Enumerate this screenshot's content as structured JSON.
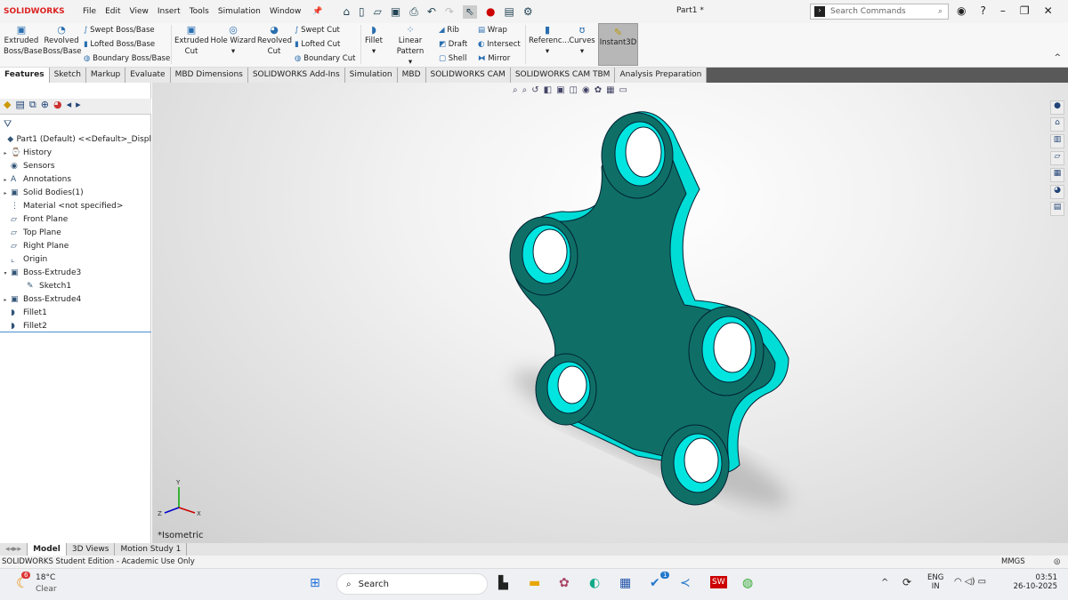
{
  "app": {
    "logo": "SOLIDWORKS",
    "title": "Part1 *",
    "search_placeholder": "Search Commands",
    "menu": [
      "File",
      "Edit",
      "View",
      "Insert",
      "Tools",
      "Simulation",
      "Window"
    ]
  },
  "ribbon": {
    "big": [
      "Extruded Boss/Base",
      "Revolved Boss/Base",
      "Extruded Cut",
      "Hole Wizard",
      "Revolved Cut",
      "Fillet",
      "Linear Pattern",
      "Referenc...",
      "Curves",
      "Instant3D"
    ],
    "small": [
      "Swept Boss/Base",
      "Lofted Boss/Base",
      "Boundary Boss/Base",
      "Swept Cut",
      "Lofted Cut",
      "Boundary Cut",
      "Rib",
      "Draft",
      "Shell",
      "Wrap",
      "Intersect",
      "Mirror"
    ]
  },
  "tabs": [
    "Features",
    "Sketch",
    "Markup",
    "Evaluate",
    "MBD Dimensions",
    "SOLIDWORKS Add-Ins",
    "Simulation",
    "MBD",
    "SOLIDWORKS CAM",
    "SOLIDWORKS CAM TBM",
    "Analysis Preparation"
  ],
  "tree": [
    {
      "label": "Part1 (Default) <<Default>_Displ",
      "arrow": "",
      "icon": "part-icon"
    },
    {
      "label": "History",
      "arrow": "▸",
      "icon": "history-icon"
    },
    {
      "label": "Sensors",
      "arrow": "",
      "icon": "sensors-icon"
    },
    {
      "label": "Annotations",
      "arrow": "▸",
      "icon": "annotations-icon"
    },
    {
      "label": "Solid Bodies(1)",
      "arrow": "▸",
      "icon": "solid-bodies-icon"
    },
    {
      "label": "Material <not specified>",
      "arrow": "",
      "icon": "material-icon"
    },
    {
      "label": "Front Plane",
      "arrow": "",
      "icon": "plane-icon"
    },
    {
      "label": "Top Plane",
      "arrow": "",
      "icon": "plane-icon"
    },
    {
      "label": "Right Plane",
      "arrow": "",
      "icon": "plane-icon"
    },
    {
      "label": "Origin",
      "arrow": "",
      "icon": "origin-icon"
    },
    {
      "label": "Boss-Extrude3",
      "arrow": "▾",
      "icon": "extrude-icon"
    },
    {
      "label": "Sketch1",
      "arrow": "",
      "icon": "sketch-icon",
      "indent": true
    },
    {
      "label": "Boss-Extrude4",
      "arrow": "▸",
      "icon": "extrude-icon"
    },
    {
      "label": "Fillet1",
      "arrow": "",
      "icon": "fillet-icon"
    },
    {
      "label": "Fillet2",
      "arrow": "",
      "icon": "fillet-icon"
    }
  ],
  "viewport": {
    "view_label": "*Isometric",
    "axes": [
      "Y",
      "X",
      "Z"
    ],
    "model_color": "#00e5e0",
    "face_color": "#0f6f66"
  },
  "bottom_tabs": [
    "Model",
    "3D Views",
    "Motion Study 1"
  ],
  "status": {
    "text": "SOLIDWORKS Student Edition - Academic Use Only",
    "units": "MMGS"
  },
  "taskbar": {
    "weather_temp": "18°C",
    "weather_text": "Clear",
    "weather_badge": "6",
    "search": "Search",
    "lang1": "ENG",
    "lang2": "IN",
    "time": "03:51",
    "date": "26-10-2025",
    "notif_badge": "1"
  }
}
